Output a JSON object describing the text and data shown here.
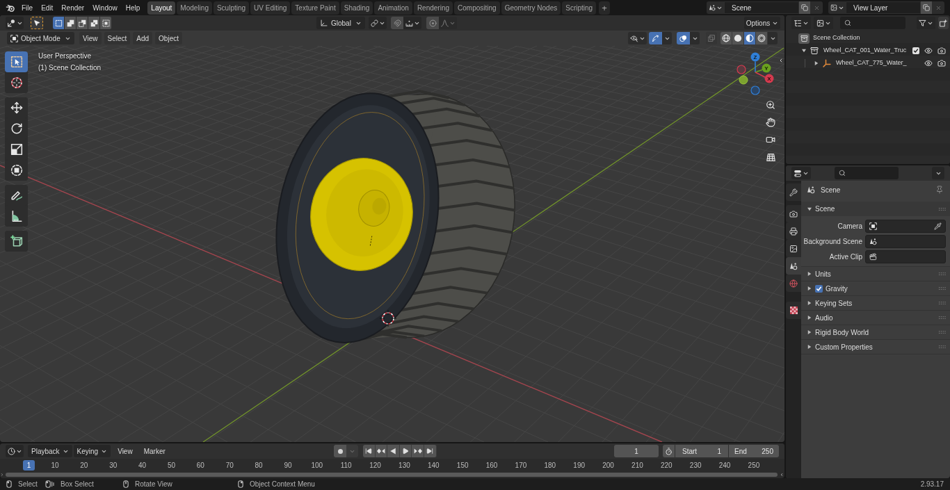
{
  "topbar": {
    "menus": [
      "File",
      "Edit",
      "Render",
      "Window",
      "Help"
    ],
    "workspaces": [
      {
        "label": "Layout",
        "selected": true
      },
      {
        "label": "Modeling",
        "selected": false
      },
      {
        "label": "Sculpting",
        "selected": false
      },
      {
        "label": "UV Editing",
        "selected": false
      },
      {
        "label": "Texture Paint",
        "selected": false
      },
      {
        "label": "Shading",
        "selected": false
      },
      {
        "label": "Animation",
        "selected": false
      },
      {
        "label": "Rendering",
        "selected": false
      },
      {
        "label": "Compositing",
        "selected": false
      },
      {
        "label": "Geometry Nodes",
        "selected": false
      },
      {
        "label": "Scripting",
        "selected": false
      }
    ],
    "add_workspace": "+",
    "scene": "Scene",
    "view_layer": "View Layer"
  },
  "viewport": {
    "tool_header": {
      "select_modes": [
        {
          "selected": true
        },
        {
          "selected": false
        },
        {
          "selected": false
        },
        {
          "selected": false
        },
        {
          "selected": false
        }
      ],
      "orientation": "Global",
      "options": "Options"
    },
    "header": {
      "mode": "Object Mode",
      "menus": [
        "View",
        "Select",
        "Add",
        "Object"
      ],
      "gizmos_on": true,
      "overlays_on": true,
      "xray_on": false,
      "shading": [
        {
          "selected": false
        },
        {
          "selected": false
        },
        {
          "selected": true
        },
        {
          "selected": false
        }
      ]
    },
    "info": [
      "User Perspective",
      "(1) Scene Collection"
    ],
    "tools": [
      {
        "selected": true
      },
      {
        "selected": false
      },
      {
        "selected": false
      },
      {
        "selected": false
      },
      {
        "selected": false
      },
      {
        "selected": false
      },
      {
        "selected": false
      },
      {
        "selected": false
      },
      {
        "selected": false
      }
    ],
    "gizmo": {
      "x": "X",
      "y": "Y",
      "z": "Z"
    }
  },
  "timeline": {
    "menus": [
      {
        "label": "Playback",
        "kind": "dropdown"
      },
      {
        "label": "Keying",
        "kind": "dropdown"
      },
      {
        "label": "View",
        "kind": "menu"
      },
      {
        "label": "Marker",
        "kind": "menu"
      }
    ],
    "auto_keying": false,
    "current_frame": "1",
    "preview_range": false,
    "start": {
      "label": "Start",
      "value": "1"
    },
    "end": {
      "label": "End",
      "value": "250"
    },
    "ruler": {
      "current": "1",
      "ticks": [
        "10",
        "20",
        "30",
        "40",
        "50",
        "60",
        "70",
        "80",
        "90",
        "100",
        "110",
        "120",
        "130",
        "140",
        "150",
        "160",
        "170",
        "180",
        "190",
        "200",
        "210",
        "220",
        "230",
        "240",
        "250"
      ]
    }
  },
  "outliner": {
    "root": {
      "label": "Scene Collection",
      "children": [
        {
          "label": "Wheel_CAT_001_Water_Truc",
          "kind": "collection",
          "expanded": true,
          "checked": true,
          "children": [
            {
              "label": "Wheel_CAT_775_Water_",
              "kind": "empty",
              "expanded": false
            }
          ]
        }
      ]
    }
  },
  "properties": {
    "tabs": [
      {
        "selected": false
      },
      {
        "selected": false
      },
      {
        "selected": false
      },
      {
        "selected": false
      },
      {
        "selected": true
      },
      {
        "selected": false
      },
      {
        "selected": false
      }
    ],
    "context": "Scene",
    "panels": [
      {
        "title": "Scene",
        "kind": "plain",
        "expanded": true,
        "fields": [
          {
            "label": "Camera"
          },
          {
            "label": "Background Scene"
          },
          {
            "label": "Active Clip"
          }
        ]
      },
      {
        "title": "Units",
        "kind": "plain",
        "expanded": false
      },
      {
        "title": "Gravity",
        "kind": "toggle",
        "expanded": false,
        "checked": true
      },
      {
        "title": "Keying Sets",
        "kind": "plain",
        "expanded": false
      },
      {
        "title": "Audio",
        "kind": "plain",
        "expanded": false
      },
      {
        "title": "Rigid Body World",
        "kind": "plain",
        "expanded": false
      },
      {
        "title": "Custom Properties",
        "kind": "plain",
        "expanded": false
      }
    ]
  },
  "status_bar": {
    "hints": [
      "Select",
      "Box Select",
      "Rotate View",
      "Object Context Menu"
    ],
    "version": "2.93.17"
  }
}
